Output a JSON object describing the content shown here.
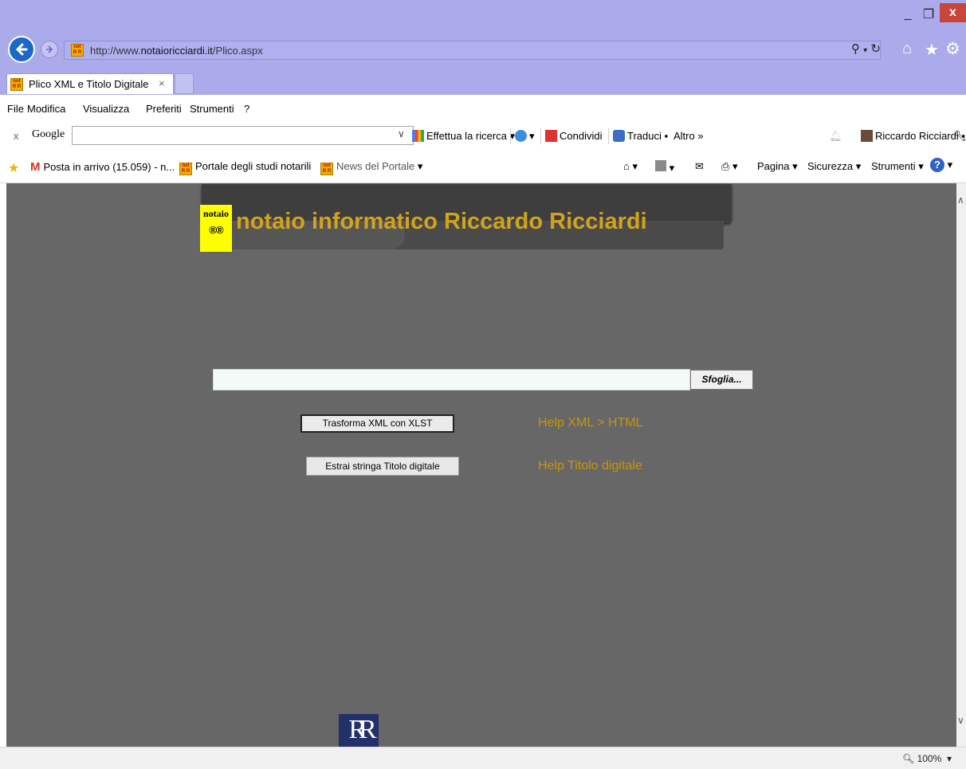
{
  "window": {
    "minimize": "_",
    "maximize": "❐",
    "close": "x"
  },
  "address_bar": {
    "url_prefix": "http://www.",
    "url_domain": "notaioricciardi.it",
    "url_path": "/Plico.aspx"
  },
  "tab": {
    "title": "Plico XML e Titolo Digitale",
    "close": "×"
  },
  "menu": [
    "File",
    "Modifica",
    "Visualizza",
    "Preferiti",
    "Strumenti",
    "?"
  ],
  "google_bar": {
    "close": "x",
    "logo": "Google",
    "search_button": "Effettua la ricerca",
    "share": "Condividi",
    "translate": "Traduci",
    "more": "Altro »",
    "user": "Riccardo Ricciardi"
  },
  "favorites": {
    "gmail": "Posta in arrivo (15.059) - n...",
    "portal": "Portale degli studi notarili",
    "news": "News del Portale"
  },
  "command_bar": {
    "page": "Pagina",
    "security": "Sicurezza",
    "tools": "Strumenti"
  },
  "page": {
    "logo_top": "notaio",
    "logo_bottom": "®®",
    "site_title": "notaio informatico Riccardo Ricciardi",
    "browse_label": "Sfoglia...",
    "transform_button": "Trasforma XML con XLST",
    "extract_button": "Estrai stringa Titolo digitale",
    "help_xml": "Help XML > HTML",
    "help_title": "Help Titolo digitale",
    "footer_logo": "RR"
  },
  "status": {
    "zoom": "100%"
  },
  "colors": {
    "chrome": "#ababeb",
    "page_background": "#676767",
    "title_gold": "#d2a31c",
    "logo_yellow": "#ffff00"
  }
}
